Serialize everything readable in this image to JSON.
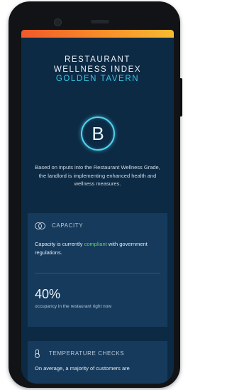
{
  "report": {
    "title_line1": "RESTAURANT",
    "title_line2": "WELLNESS INDEX",
    "venue": "GOLDEN TAVERN",
    "grade": "B",
    "intro": "Based on inputs into the Restaurant Wellness Grade, the landlord is implementing enhanced health and wellness measures."
  },
  "capacity": {
    "label": "CAPACITY",
    "icon": "capacity-rings-icon",
    "status_prefix": "Capacity is currently ",
    "status_word": "compliant",
    "status_suffix": " with government regulations.",
    "occupancy": "40%",
    "occupancy_caption": "occupancy in the restaurant right now"
  },
  "temperature": {
    "label": "TEMPERATURE CHECKS",
    "icon": "thermometer-icon",
    "text": "On average, a majority of customers are"
  },
  "colors": {
    "background": "#0d2a44",
    "card": "#163a5c",
    "accent": "#37c6e6",
    "compliant": "#69d46b",
    "gradient_start": "#f0592a",
    "gradient_end": "#f7bb31"
  }
}
